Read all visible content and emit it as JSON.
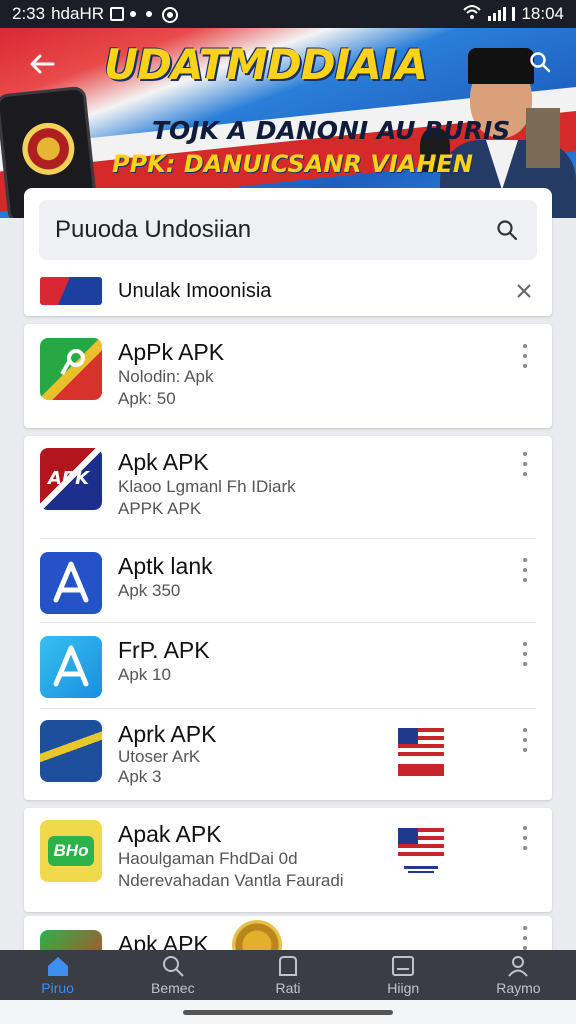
{
  "status_bar": {
    "time_left": "2:33",
    "carrier": "hdaHR",
    "time_right": "18:04"
  },
  "banner": {
    "title": "UDATMDDIAIA",
    "subtitle_1": "TOJK A DANONI AU RURIS",
    "subtitle_2": "PPK: DANUICSANR VIAHEN"
  },
  "search": {
    "query": "Puuoda Undosiian",
    "suggestion": "Unulak Imoonisia"
  },
  "apps": [
    {
      "name": "ApPk APK",
      "line1": "Nolodin: Apk",
      "line2": "Apk: 50"
    },
    {
      "name": "Apk APK",
      "line1": "Klaoo Lgmanl Fh IDiark",
      "line2": "APPK APK"
    },
    {
      "name": "Aptk lank",
      "line1": "Apk 350",
      "line2": ""
    },
    {
      "name": "FrP. APK",
      "line1": "Apk 10",
      "line2": ""
    },
    {
      "name": "Aprk APK",
      "line1": "Utoser ArK",
      "line2": "Apk 3"
    },
    {
      "name": "Apak APK",
      "line1": "Haoulgaman FhdDai 0d",
      "line2": "Nderevahadan Vantla Fauradi"
    },
    {
      "name": "Apk APK",
      "line1": "",
      "line2": ""
    }
  ],
  "app_icon_labels": {
    "apk_badge": "APK",
    "green_badge": "BHo"
  },
  "bottom_nav": [
    {
      "label": "Piruo",
      "icon": "home-icon",
      "active": true
    },
    {
      "label": "Bemec",
      "icon": "search-icon",
      "active": false
    },
    {
      "label": "Rati",
      "icon": "library-icon",
      "active": false
    },
    {
      "label": "Hiign",
      "icon": "updates-icon",
      "active": false
    },
    {
      "label": "Raymo",
      "icon": "account-icon",
      "active": false
    }
  ],
  "colors": {
    "accent": "#3d8ef0",
    "nav_bg": "#3b3d44",
    "banner_yellow": "#ffd21a"
  }
}
